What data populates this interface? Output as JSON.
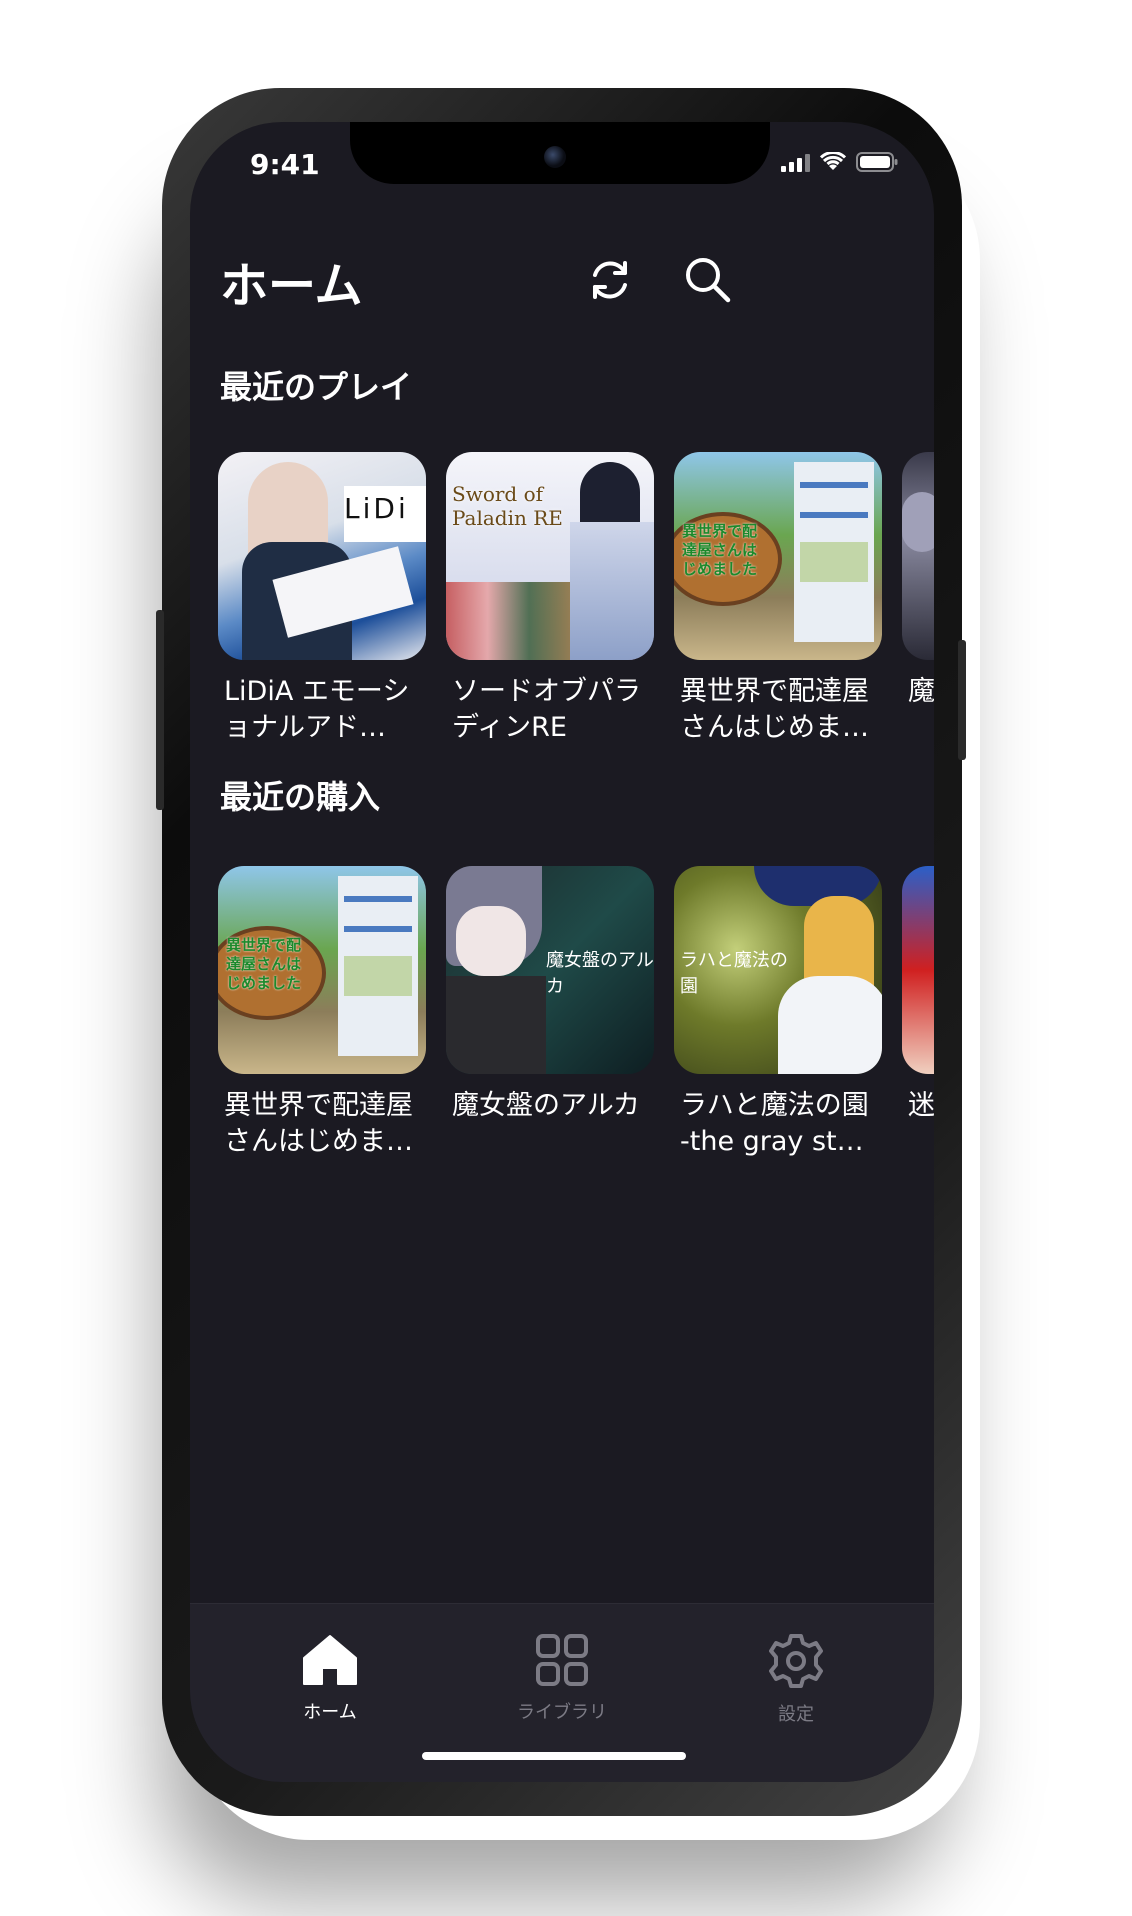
{
  "status": {
    "time": "9:41"
  },
  "header": {
    "title": "ホーム",
    "refresh_icon": "refresh-icon",
    "search_icon": "search-icon"
  },
  "sections": [
    {
      "title": "最近のプレイ",
      "items": [
        {
          "title": "LiDiA エモーショナルアド…",
          "thumb_text": "LiDi"
        },
        {
          "title": "ソードオブパラディンRE",
          "thumb_text": "Sword of Paladin RE"
        },
        {
          "title": "異世界で配達屋さんはじめま…",
          "thumb_text": "異世界で配達屋さんはじめました"
        },
        {
          "title": "魔"
        }
      ]
    },
    {
      "title": "最近の購入",
      "items": [
        {
          "title": "異世界で配達屋さんはじめま…",
          "thumb_text": "異世界で配達屋さんはじめました"
        },
        {
          "title": "魔女盤のアルカ",
          "thumb_text": "魔女盤のアルカ"
        },
        {
          "title": "ラハと魔法の園 -the gray st…",
          "thumb_text": "ラハと魔法の園"
        },
        {
          "title": "迷 ン"
        }
      ]
    }
  ],
  "tabs": [
    {
      "label": "ホーム",
      "icon": "home-icon",
      "active": true
    },
    {
      "label": "ライブラリ",
      "icon": "grid-icon",
      "active": false
    },
    {
      "label": "設定",
      "icon": "gear-icon",
      "active": false
    }
  ],
  "colors": {
    "background": "#1b1a22",
    "tabbar": "#23222b",
    "active": "#ffffff",
    "inactive": "#7c7b85"
  }
}
